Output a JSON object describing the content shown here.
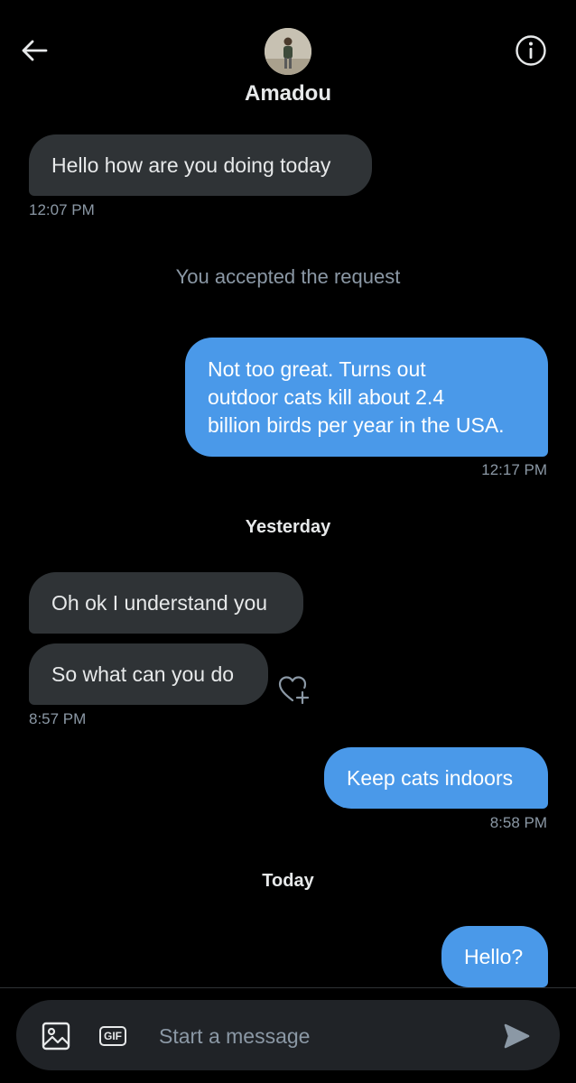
{
  "header": {
    "back_icon": "arrow-left-icon",
    "info_icon": "info-icon",
    "contact_name": "Amadou"
  },
  "messages": [
    {
      "direction": "incoming",
      "text": "Hello how are you doing today",
      "time": "12:07 PM"
    },
    {
      "type": "system",
      "text": "You accepted the request"
    },
    {
      "direction": "outgoing",
      "text": "Not too great. Turns out\noutdoor cats kill about 2.4\nbillion birds per year in the USA.",
      "time": "12:17 PM"
    },
    {
      "type": "day",
      "text": "Yesterday"
    },
    {
      "direction": "incoming",
      "text": "Oh ok I understand you"
    },
    {
      "direction": "incoming",
      "text": "So what can you do",
      "time": "8:57 PM"
    },
    {
      "direction": "outgoing",
      "text": "Keep cats indoors",
      "time": "8:58 PM"
    },
    {
      "type": "day",
      "text": "Today"
    },
    {
      "direction": "outgoing",
      "text": "Hello?"
    }
  ],
  "composer": {
    "media_icon": "image-icon",
    "gif_label": "GIF",
    "placeholder": "Start a message",
    "value": "",
    "send_icon": "send-icon"
  },
  "colors": {
    "background": "#000000",
    "incoming_bubble": "#2f3336",
    "outgoing_bubble": "#4a99e9",
    "secondary_text": "#8b98a5",
    "composer_bg": "#202327"
  }
}
